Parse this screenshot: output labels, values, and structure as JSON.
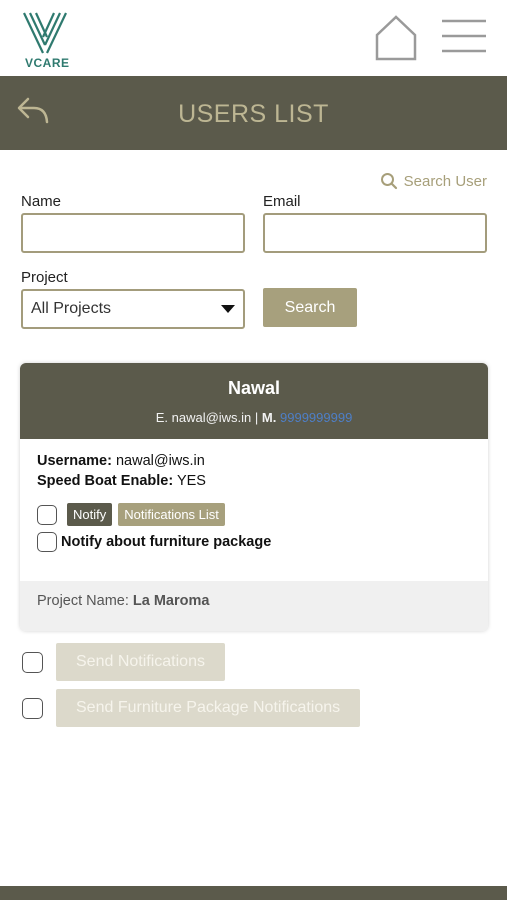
{
  "header": {
    "logo_text": "VCARE",
    "brand_color": "#2f7a6f",
    "icons": {
      "home": "home-icon",
      "menu": "hamburger-menu-icon"
    }
  },
  "titlebar": {
    "title": "USERS LIST",
    "back_icon": "reply-back-icon",
    "bar_color": "#5b5a4b"
  },
  "search": {
    "link_label": "Search User",
    "name_label": "Name",
    "name_value": "",
    "email_label": "Email",
    "email_value": "",
    "project_label": "Project",
    "project_selected": "All Projects",
    "button_label": "Search"
  },
  "user_card": {
    "name": "Nawal",
    "email_prefix": "E.",
    "email": "nawal@iws.in",
    "separator": "|",
    "mobile_prefix": "M.",
    "mobile": "9999999999",
    "username_label": "Username:",
    "username": "nawal@iws.in",
    "speedboat_label": "Speed Boat Enable:",
    "speedboat": "YES",
    "notify_label": "Notify",
    "notifications_list_label": "Notifications List",
    "furniture_label": "Notify about furniture package",
    "project_name_label": "Project Name:",
    "project_name": "La Maroma"
  },
  "actions": {
    "send_notifications": "Send Notifications",
    "send_furniture": "Send Furniture Package Notifications"
  },
  "colors": {
    "accent": "#a7a07d",
    "dark": "#5b5a4b",
    "disabled": "#dcd9cb"
  }
}
